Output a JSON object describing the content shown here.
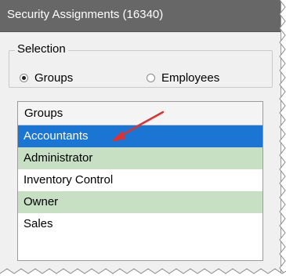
{
  "window": {
    "title": "Security Assignments (16340)"
  },
  "selection": {
    "legend": "Selection",
    "options": [
      {
        "label": "Groups",
        "checked": true
      },
      {
        "label": "Employees",
        "checked": false
      }
    ]
  },
  "grid": {
    "header": "Groups",
    "rows": [
      "Accountants",
      "Administrator",
      "Inventory Control",
      "Owner",
      "Sales"
    ],
    "selected_row": "Accountants"
  },
  "colors": {
    "titlebar": "#676767",
    "selected_row": "#1a75d3",
    "alt_row": "#c7e0c3",
    "callout_arrow": "#e03030"
  }
}
